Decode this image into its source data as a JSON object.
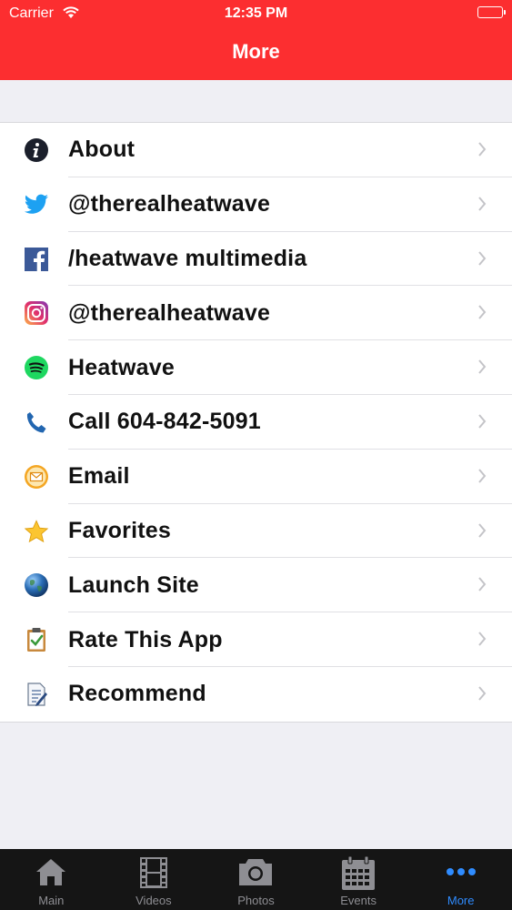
{
  "status": {
    "carrier": "Carrier",
    "time": "12:35 PM"
  },
  "header": {
    "title": "More"
  },
  "items": [
    {
      "label": "About",
      "icon": "info-icon"
    },
    {
      "label": "@therealheatwave",
      "icon": "twitter-icon"
    },
    {
      "label": "/heatwave multimedia",
      "icon": "facebook-icon"
    },
    {
      "label": "@therealheatwave",
      "icon": "instagram-icon"
    },
    {
      "label": "Heatwave",
      "icon": "spotify-icon"
    },
    {
      "label": "Call 604-842-5091",
      "icon": "phone-icon"
    },
    {
      "label": "Email",
      "icon": "email-icon"
    },
    {
      "label": "Favorites",
      "icon": "star-icon"
    },
    {
      "label": "Launch Site",
      "icon": "globe-icon"
    },
    {
      "label": "Rate This App",
      "icon": "clipboard-icon"
    },
    {
      "label": "Recommend",
      "icon": "document-icon"
    }
  ],
  "tabs": [
    {
      "label": "Main",
      "icon": "home-icon"
    },
    {
      "label": "Videos",
      "icon": "film-icon"
    },
    {
      "label": "Photos",
      "icon": "camera-icon"
    },
    {
      "label": "Events",
      "icon": "calendar-icon"
    },
    {
      "label": "More",
      "icon": "more-dots-icon",
      "active": true
    }
  ],
  "colors": {
    "header": "#fc2e30",
    "tab_active": "#2f8cff",
    "tab_inactive": "#8e8e93"
  }
}
